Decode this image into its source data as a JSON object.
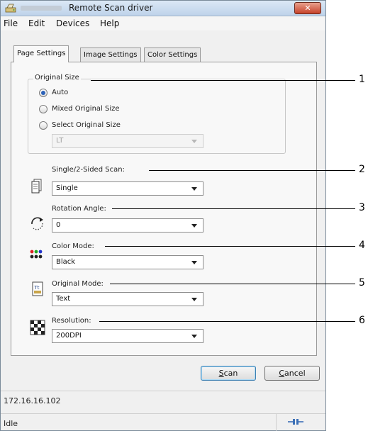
{
  "window": {
    "title": "Remote Scan driver",
    "close_label": "✕"
  },
  "menu": {
    "file": "File",
    "edit": "Edit",
    "devices": "Devices",
    "help": "Help"
  },
  "tabs": [
    {
      "label": "Page Settings",
      "active": true
    },
    {
      "label": "Image Settings",
      "active": false
    },
    {
      "label": "Color Settings",
      "active": false
    }
  ],
  "original_size": {
    "legend": "Original Size",
    "options": [
      "Auto",
      "Mixed Original Size",
      "Select Original Size"
    ],
    "selected": "Auto",
    "size_select_value": "LT"
  },
  "single_2_sided": {
    "label": "Single/2-Sided Scan:",
    "value": "Single"
  },
  "rotation": {
    "label": "Rotation Angle:",
    "value": "0"
  },
  "color_mode": {
    "label": "Color Mode:",
    "value": "Black"
  },
  "original_mode": {
    "label": "Original Mode:",
    "value": "Text"
  },
  "resolution": {
    "label": "Resolution:",
    "value": "200DPI"
  },
  "buttons": {
    "scan_first": "S",
    "scan_rest": "can",
    "cancel_first": "C",
    "cancel_rest": "ancel"
  },
  "status": {
    "address": "172.16.16.102",
    "state": "Idle"
  },
  "callouts": [
    "1",
    "2",
    "3",
    "4",
    "5",
    "6"
  ]
}
